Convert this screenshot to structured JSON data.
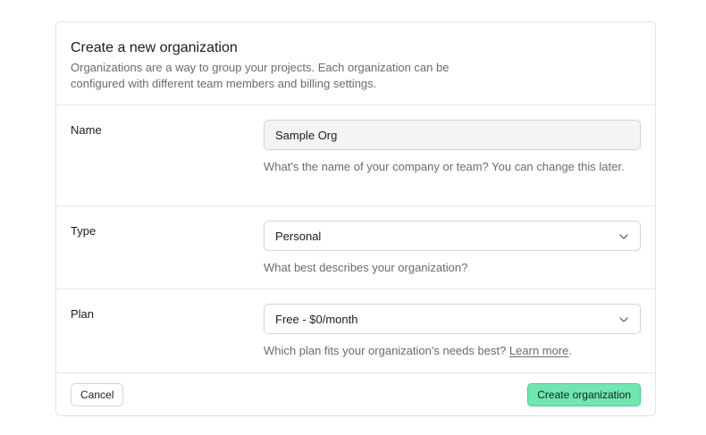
{
  "header": {
    "title": "Create a new organization",
    "subtitle": "Organizations are a way to group your projects. Each organization can be configured with different team members and billing settings."
  },
  "fields": {
    "name": {
      "label": "Name",
      "value": "Sample Org",
      "help": "What's the name of your company or team? You can change this later."
    },
    "type": {
      "label": "Type",
      "selected": "Personal",
      "help": "What best describes your organization?"
    },
    "plan": {
      "label": "Plan",
      "selected": "Free - $0/month",
      "help_prefix": "Which plan fits your organization's needs best? ",
      "help_link": "Learn more",
      "help_suffix": "."
    }
  },
  "footer": {
    "cancel_label": "Cancel",
    "submit_label": "Create organization"
  },
  "colors": {
    "primary_bg": "#6ee7b0",
    "primary_border": "#3ecf8e",
    "border": "#e4e4e7",
    "muted_text": "#6b6b6b"
  },
  "icons": {
    "select_chevron": "chevron-down-icon"
  }
}
